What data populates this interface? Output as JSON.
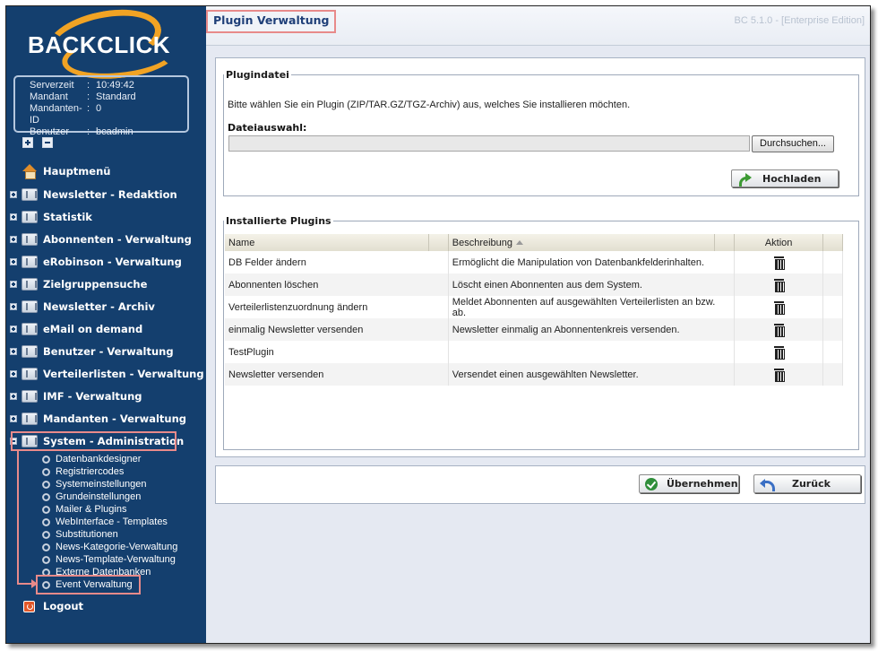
{
  "app": {
    "logo_text": "BACKCLICK",
    "version": "BC 5.1.0 - [Enterprise Edition]"
  },
  "info": {
    "rows": [
      {
        "key": "Serverzeit",
        "value": "10:49:42"
      },
      {
        "key": "Mandant",
        "value": "Standard"
      },
      {
        "key": "Mandanten-ID",
        "value": "0"
      },
      {
        "key": "Benutzer",
        "value": "bcadmin"
      }
    ]
  },
  "nav": {
    "home": "Hauptmenü",
    "items": [
      "Newsletter - Redaktion",
      "Statistik",
      "Abonnenten - Verwaltung",
      "eRobinson - Verwaltung",
      "Zielgruppensuche",
      "Newsletter - Archiv",
      "eMail on demand",
      "Benutzer - Verwaltung",
      "Verteilerlisten - Verwaltung",
      "IMF - Verwaltung",
      "Mandanten - Verwaltung",
      "System - Administration"
    ],
    "subitems": [
      "Datenbankdesigner",
      "Registriercodes",
      "Systemeinstellungen",
      "Grundeinstellungen",
      "Mailer & Plugins",
      "WebInterface - Templates",
      "Substitutionen",
      "News-Kategorie-Verwaltung",
      "News-Template-Verwaltung",
      "Externe Datenbanken",
      "Event Verwaltung"
    ],
    "logout": "Logout"
  },
  "page": {
    "title": "Plugin Verwaltung"
  },
  "upload": {
    "legend": "Plugindatei",
    "intro": "Bitte wählen Sie ein Plugin (ZIP/TAR.GZ/TGZ-Archiv) aus, welches Sie installieren möchten.",
    "file_label": "Dateiauswahl:",
    "file_value": "",
    "browse_label": "Durchsuchen...",
    "upload_label": "Hochladen"
  },
  "plugins": {
    "legend": "Installierte Plugins",
    "columns": [
      "Name",
      "Beschreibung",
      "Aktion"
    ],
    "rows": [
      {
        "name": "DB Felder ändern",
        "desc": "Ermöglicht die Manipulation von Datenbankfelderinhalten."
      },
      {
        "name": "Abonnenten löschen",
        "desc": "Löscht einen Abonnenten aus dem System."
      },
      {
        "name": "Verteilerlistenzuordnung ändern",
        "desc": "Meldet Abonnenten auf ausgewählten Verteilerlisten an bzw. ab."
      },
      {
        "name": "einmalig Newsletter versenden",
        "desc": "Newsletter einmalig an Abonnentenkreis versenden."
      },
      {
        "name": "TestPlugin",
        "desc": ""
      },
      {
        "name": "Newsletter versenden",
        "desc": "Versendet einen ausgewählten Newsletter."
      }
    ]
  },
  "actions": {
    "apply_label": "Übernehmen",
    "back_label": "Zurück"
  }
}
